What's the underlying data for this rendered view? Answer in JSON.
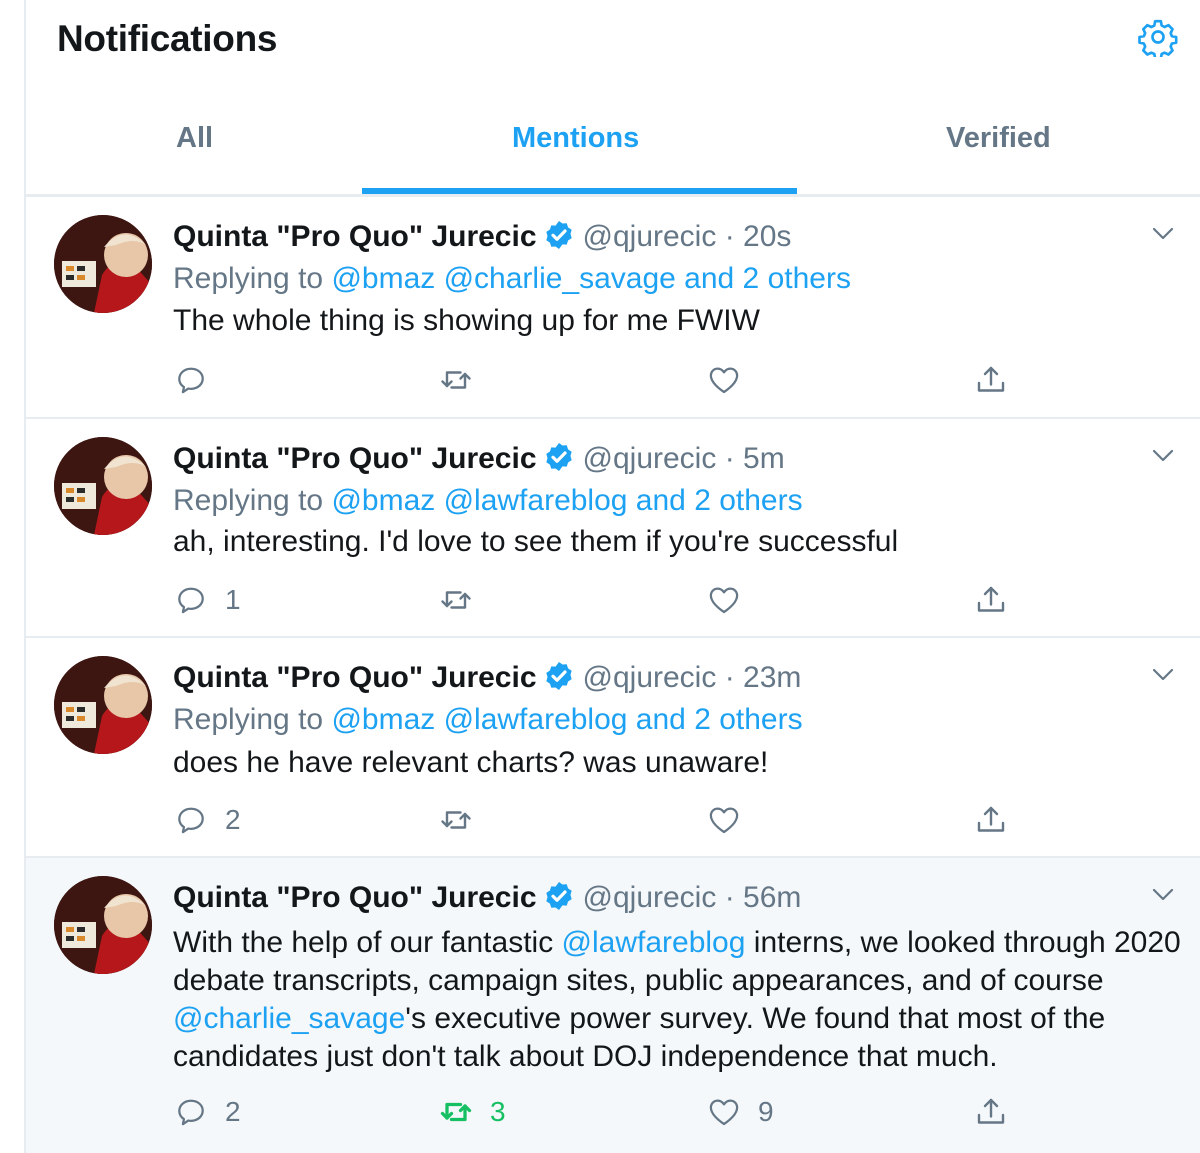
{
  "header": {
    "title": "Notifications",
    "settings_icon": "gear-icon"
  },
  "tabs": [
    {
      "label": "All"
    },
    {
      "label": "Mentions",
      "active": true
    },
    {
      "label": "Verified"
    }
  ],
  "tweets": [
    {
      "name": "Quinta \"Pro Quo\" Jurecic",
      "handle": "@qjurecic",
      "dot": "·",
      "time": "20s",
      "replying_prefix": "Replying to",
      "replying_to": "@bmaz @charlie_savage and 2 others",
      "text": "The whole thing is showing up for me FWIW",
      "replies": "",
      "retweets": "",
      "likes": ""
    },
    {
      "name": "Quinta \"Pro Quo\" Jurecic",
      "handle": "@qjurecic",
      "dot": "·",
      "time": "5m",
      "replying_prefix": "Replying to",
      "replying_to": "@bmaz @lawfareblog and 2 others",
      "text": "ah, interesting. I'd love to see them if you're successful",
      "replies": "1",
      "retweets": "",
      "likes": ""
    },
    {
      "name": "Quinta \"Pro Quo\" Jurecic",
      "handle": "@qjurecic",
      "dot": "·",
      "time": "23m",
      "replying_prefix": "Replying to",
      "replying_to": "@bmaz @lawfareblog and 2 others",
      "text": "does he have relevant charts? was unaware!",
      "replies": "2",
      "retweets": "",
      "likes": ""
    },
    {
      "name": "Quinta \"Pro Quo\" Jurecic",
      "handle": "@qjurecic",
      "dot": "·",
      "time": "56m",
      "text_parts": [
        "With the help of our fantastic ",
        "@lawfareblog",
        " interns, we looked through 2020 debate transcripts, campaign sites, public appearances, and of course ",
        "@charlie_savage",
        "'s executive power survey. We found that most of the candidates just don't talk about DOJ independence that much."
      ],
      "replies": "2",
      "retweets": "3",
      "likes": "9",
      "retweeted": true
    }
  ],
  "colors": {
    "accent": "#1da1f2",
    "retweet_active": "#17bf63",
    "muted": "#657786",
    "divider": "#e6ecf0"
  }
}
